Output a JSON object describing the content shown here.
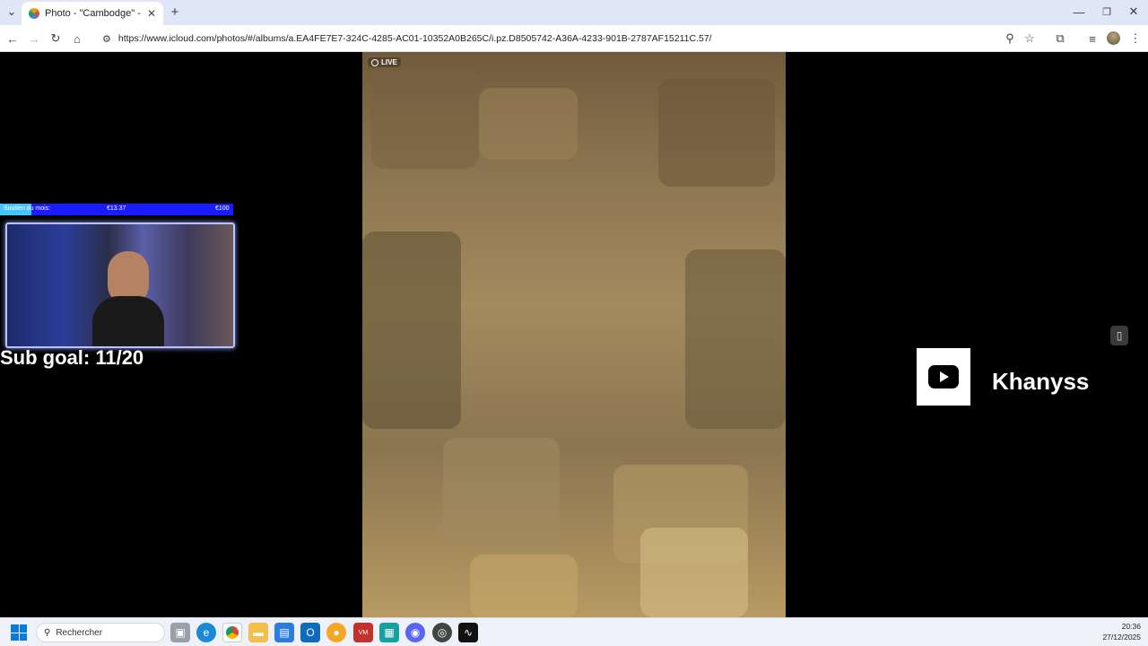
{
  "browser": {
    "tab_title": "Photo - \"Cambodge\" - iCloud F",
    "tab_close": "✕",
    "new_tab": "+",
    "url": "https://www.icloud.com/photos/#/albums/a.EA4FE7E7-324C-4285-AC01-10352A0B265C/i.pz.D8505742-A36A-4233-901B-2787AF15211C.57/",
    "window_controls": [
      "—",
      "❐",
      "✕"
    ]
  },
  "photo": {
    "live_badge": "LIVE"
  },
  "stream_overlay": {
    "goal_bar": {
      "label": "Soutien du mois:",
      "current": "€13.37",
      "target": "€100",
      "progress": 0.1337
    },
    "sub_goal": "Sub goal: 11/20",
    "channel_name": "Khanyss"
  },
  "taskbar": {
    "search_placeholder": "Rechercher",
    "time": "20:36",
    "date": "27/12/2025"
  },
  "colors": {
    "goal_bar_bg": "#1b1bff",
    "goal_bar_fill": "#46c4ff",
    "tabstrip": "#dfe6f5"
  }
}
